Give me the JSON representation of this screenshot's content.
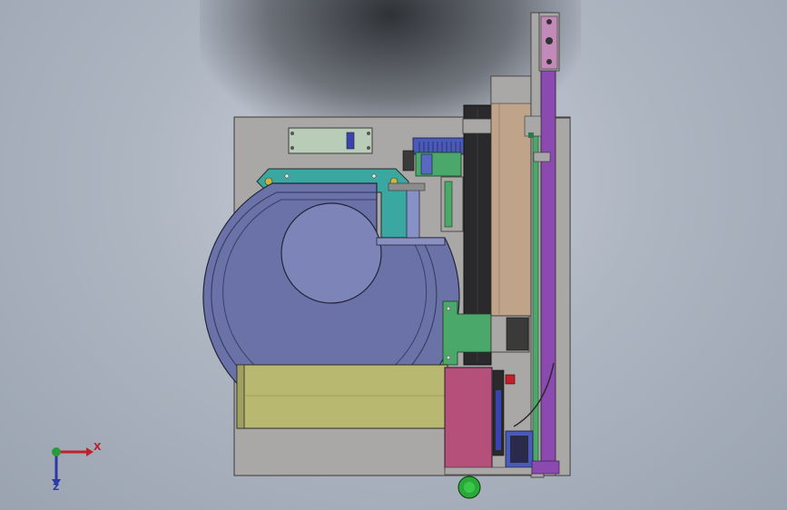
{
  "triad": {
    "x_label": "X",
    "z_label": "Z",
    "x_color": "#c0202a",
    "z_color": "#2a3aa8",
    "y_color": "#2a9a3a"
  },
  "colors": {
    "base_plate": "#a9a8a6",
    "bowl": "#6a72a8",
    "bowl_inner": "#7c84b8",
    "track_yellow": "#b8b870",
    "magenta_block": "#b4507a",
    "purple_rail": "#8a4ab0",
    "green_bracket": "#4aa86a",
    "teal_bracket": "#3aa8a0",
    "dark_belt": "#2a2a2c",
    "wood_column": "#c0a48a",
    "blue_motor": "#4a5ab8"
  }
}
